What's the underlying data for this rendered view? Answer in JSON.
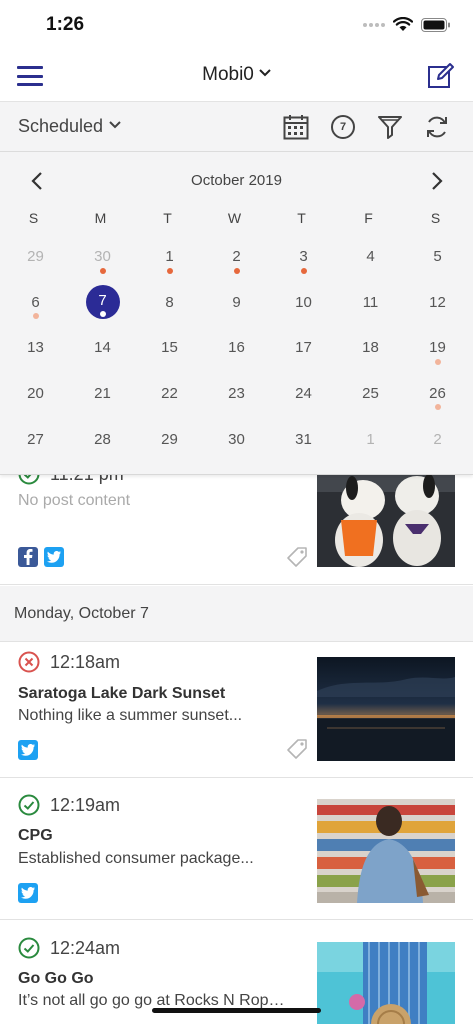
{
  "status_bar": {
    "time": "1:26"
  },
  "nav": {
    "title": "Mobi0"
  },
  "filter": {
    "label": "Scheduled",
    "count": "7"
  },
  "calendar": {
    "month": "October 2019",
    "weekdays": [
      "S",
      "M",
      "T",
      "W",
      "T",
      "F",
      "S"
    ],
    "weeks": [
      [
        {
          "n": "29",
          "muted": true
        },
        {
          "n": "30",
          "muted": true,
          "dot": "strong"
        },
        {
          "n": "1",
          "dot": "strong"
        },
        {
          "n": "2",
          "dot": "strong"
        },
        {
          "n": "3",
          "dot": "strong"
        },
        {
          "n": "4"
        },
        {
          "n": "5"
        }
      ],
      [
        {
          "n": "6",
          "dot": "light"
        },
        {
          "n": "7",
          "selected": true,
          "dot": "white"
        },
        {
          "n": "8"
        },
        {
          "n": "9"
        },
        {
          "n": "10"
        },
        {
          "n": "11"
        },
        {
          "n": "12"
        }
      ],
      [
        {
          "n": "13"
        },
        {
          "n": "14"
        },
        {
          "n": "15"
        },
        {
          "n": "16"
        },
        {
          "n": "17"
        },
        {
          "n": "18"
        },
        {
          "n": "19",
          "dot": "light"
        }
      ],
      [
        {
          "n": "20"
        },
        {
          "n": "21"
        },
        {
          "n": "22"
        },
        {
          "n": "23"
        },
        {
          "n": "24"
        },
        {
          "n": "25"
        },
        {
          "n": "26",
          "dot": "light"
        }
      ],
      [
        {
          "n": "27"
        },
        {
          "n": "28"
        },
        {
          "n": "29"
        },
        {
          "n": "30"
        },
        {
          "n": "31"
        },
        {
          "n": "1",
          "muted": true
        },
        {
          "n": "2",
          "muted": true
        }
      ]
    ]
  },
  "feed": {
    "partial_post": {
      "time": "11:21 pm",
      "body": "No post content"
    },
    "section_header": "Monday, October 7",
    "posts": [
      {
        "status": "error",
        "time": "12:18am",
        "title": "Saratoga Lake Dark Sunset",
        "body": "Nothing like a summer sunset..."
      },
      {
        "status": "success",
        "time": "12:19am",
        "title": "CPG",
        "body": "Established consumer package..."
      },
      {
        "status": "success",
        "time": "12:24am",
        "title": "Go Go Go",
        "body": "It’s not all go go go at Rocks N Ropes..."
      }
    ]
  },
  "colors": {
    "brand": "#2b2f8e",
    "success": "#2a8a3e",
    "error": "#d9534f",
    "event_dot": "#e6683c"
  }
}
